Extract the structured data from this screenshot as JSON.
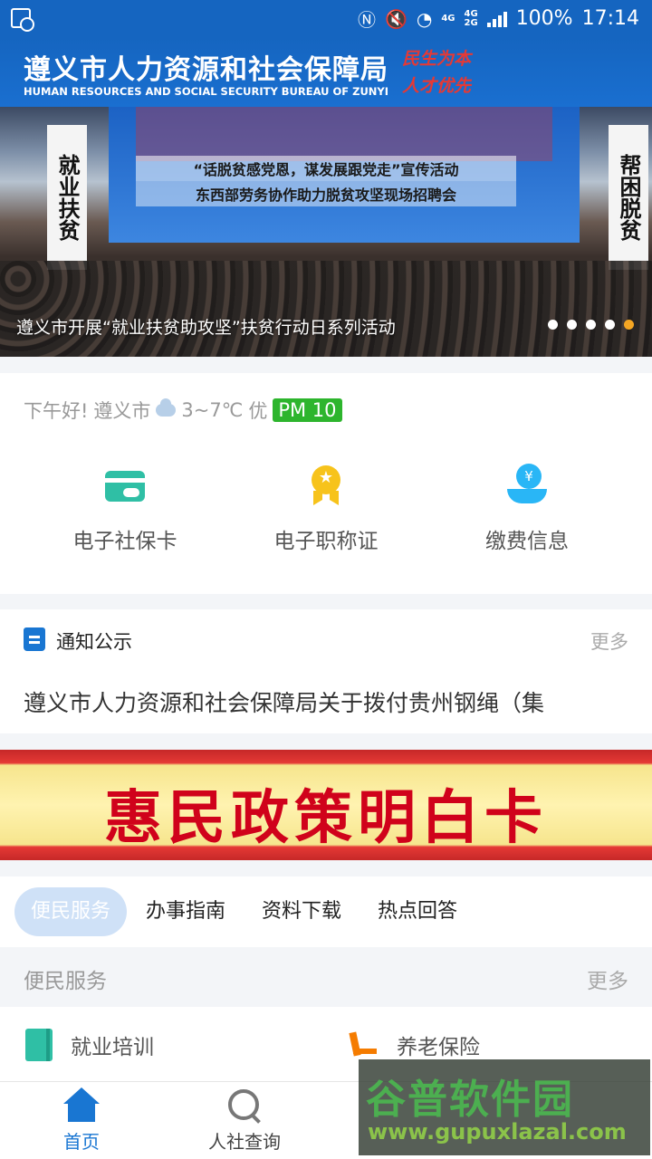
{
  "status_bar": {
    "battery": "100%",
    "time": "17:14",
    "network_top": "4G",
    "network_bottom": "2G",
    "network_left": "4G",
    "icons": [
      "screen-record-icon",
      "nfc-icon",
      "mute-icon",
      "wifi-icon",
      "signal-icon"
    ]
  },
  "header": {
    "title_cn": "遵义市人力资源和社会保障局",
    "title_en": "HUMAN RESOURCES AND SOCIAL SECURITY BUREAU OF ZUNYI",
    "slogan_line1": "民生为本",
    "slogan_line2": "人才优先",
    "brand_color": "#1565c0"
  },
  "banner": {
    "stage_line1": "“话脱贫感党恩，谋发展跟党走”宣传活动",
    "stage_line2": "东西部劳务协作助力脱贫攻坚现场招聘会",
    "left_sign": "就业扶贫",
    "right_sign": "帮困脱贫",
    "caption": "遵义市开展“就业扶贫助攻坚”扶贫行动日系列活动",
    "slide_count": 5,
    "active_slide": 5
  },
  "weather": {
    "greeting": "下午好!",
    "city": "遵义市",
    "temperature": "3~7℃",
    "air_quality": "优",
    "pm_badge": "PM 10"
  },
  "quick_actions": [
    {
      "label": "电子社保卡",
      "icon": "social-security-card-icon"
    },
    {
      "label": "电子职称证",
      "icon": "medal-icon"
    },
    {
      "label": "缴费信息",
      "icon": "payment-hand-icon"
    }
  ],
  "notice": {
    "title": "通知公示",
    "more": "更多",
    "item": "遵义市人力资源和社会保障局关于拨付贵州钢绳（集"
  },
  "policy_banner": {
    "text": "惠民政策明白卡"
  },
  "tabs": [
    {
      "label": "便民服务",
      "active": true
    },
    {
      "label": "办事指南",
      "active": false
    },
    {
      "label": "资料下载",
      "active": false
    },
    {
      "label": "热点回答",
      "active": false
    }
  ],
  "section": {
    "title": "便民服务",
    "more": "更多"
  },
  "services": [
    {
      "label": "就业培训",
      "icon": "book-icon"
    },
    {
      "label": "养老保险",
      "icon": "chair-icon"
    }
  ],
  "bottom_nav": [
    {
      "label": "首页",
      "icon": "home-icon",
      "active": true
    },
    {
      "label": "人社查询",
      "icon": "search-icon",
      "active": false
    }
  ],
  "watermark": {
    "name": "谷普软件园",
    "url": "www.gupuxlazal.com"
  }
}
